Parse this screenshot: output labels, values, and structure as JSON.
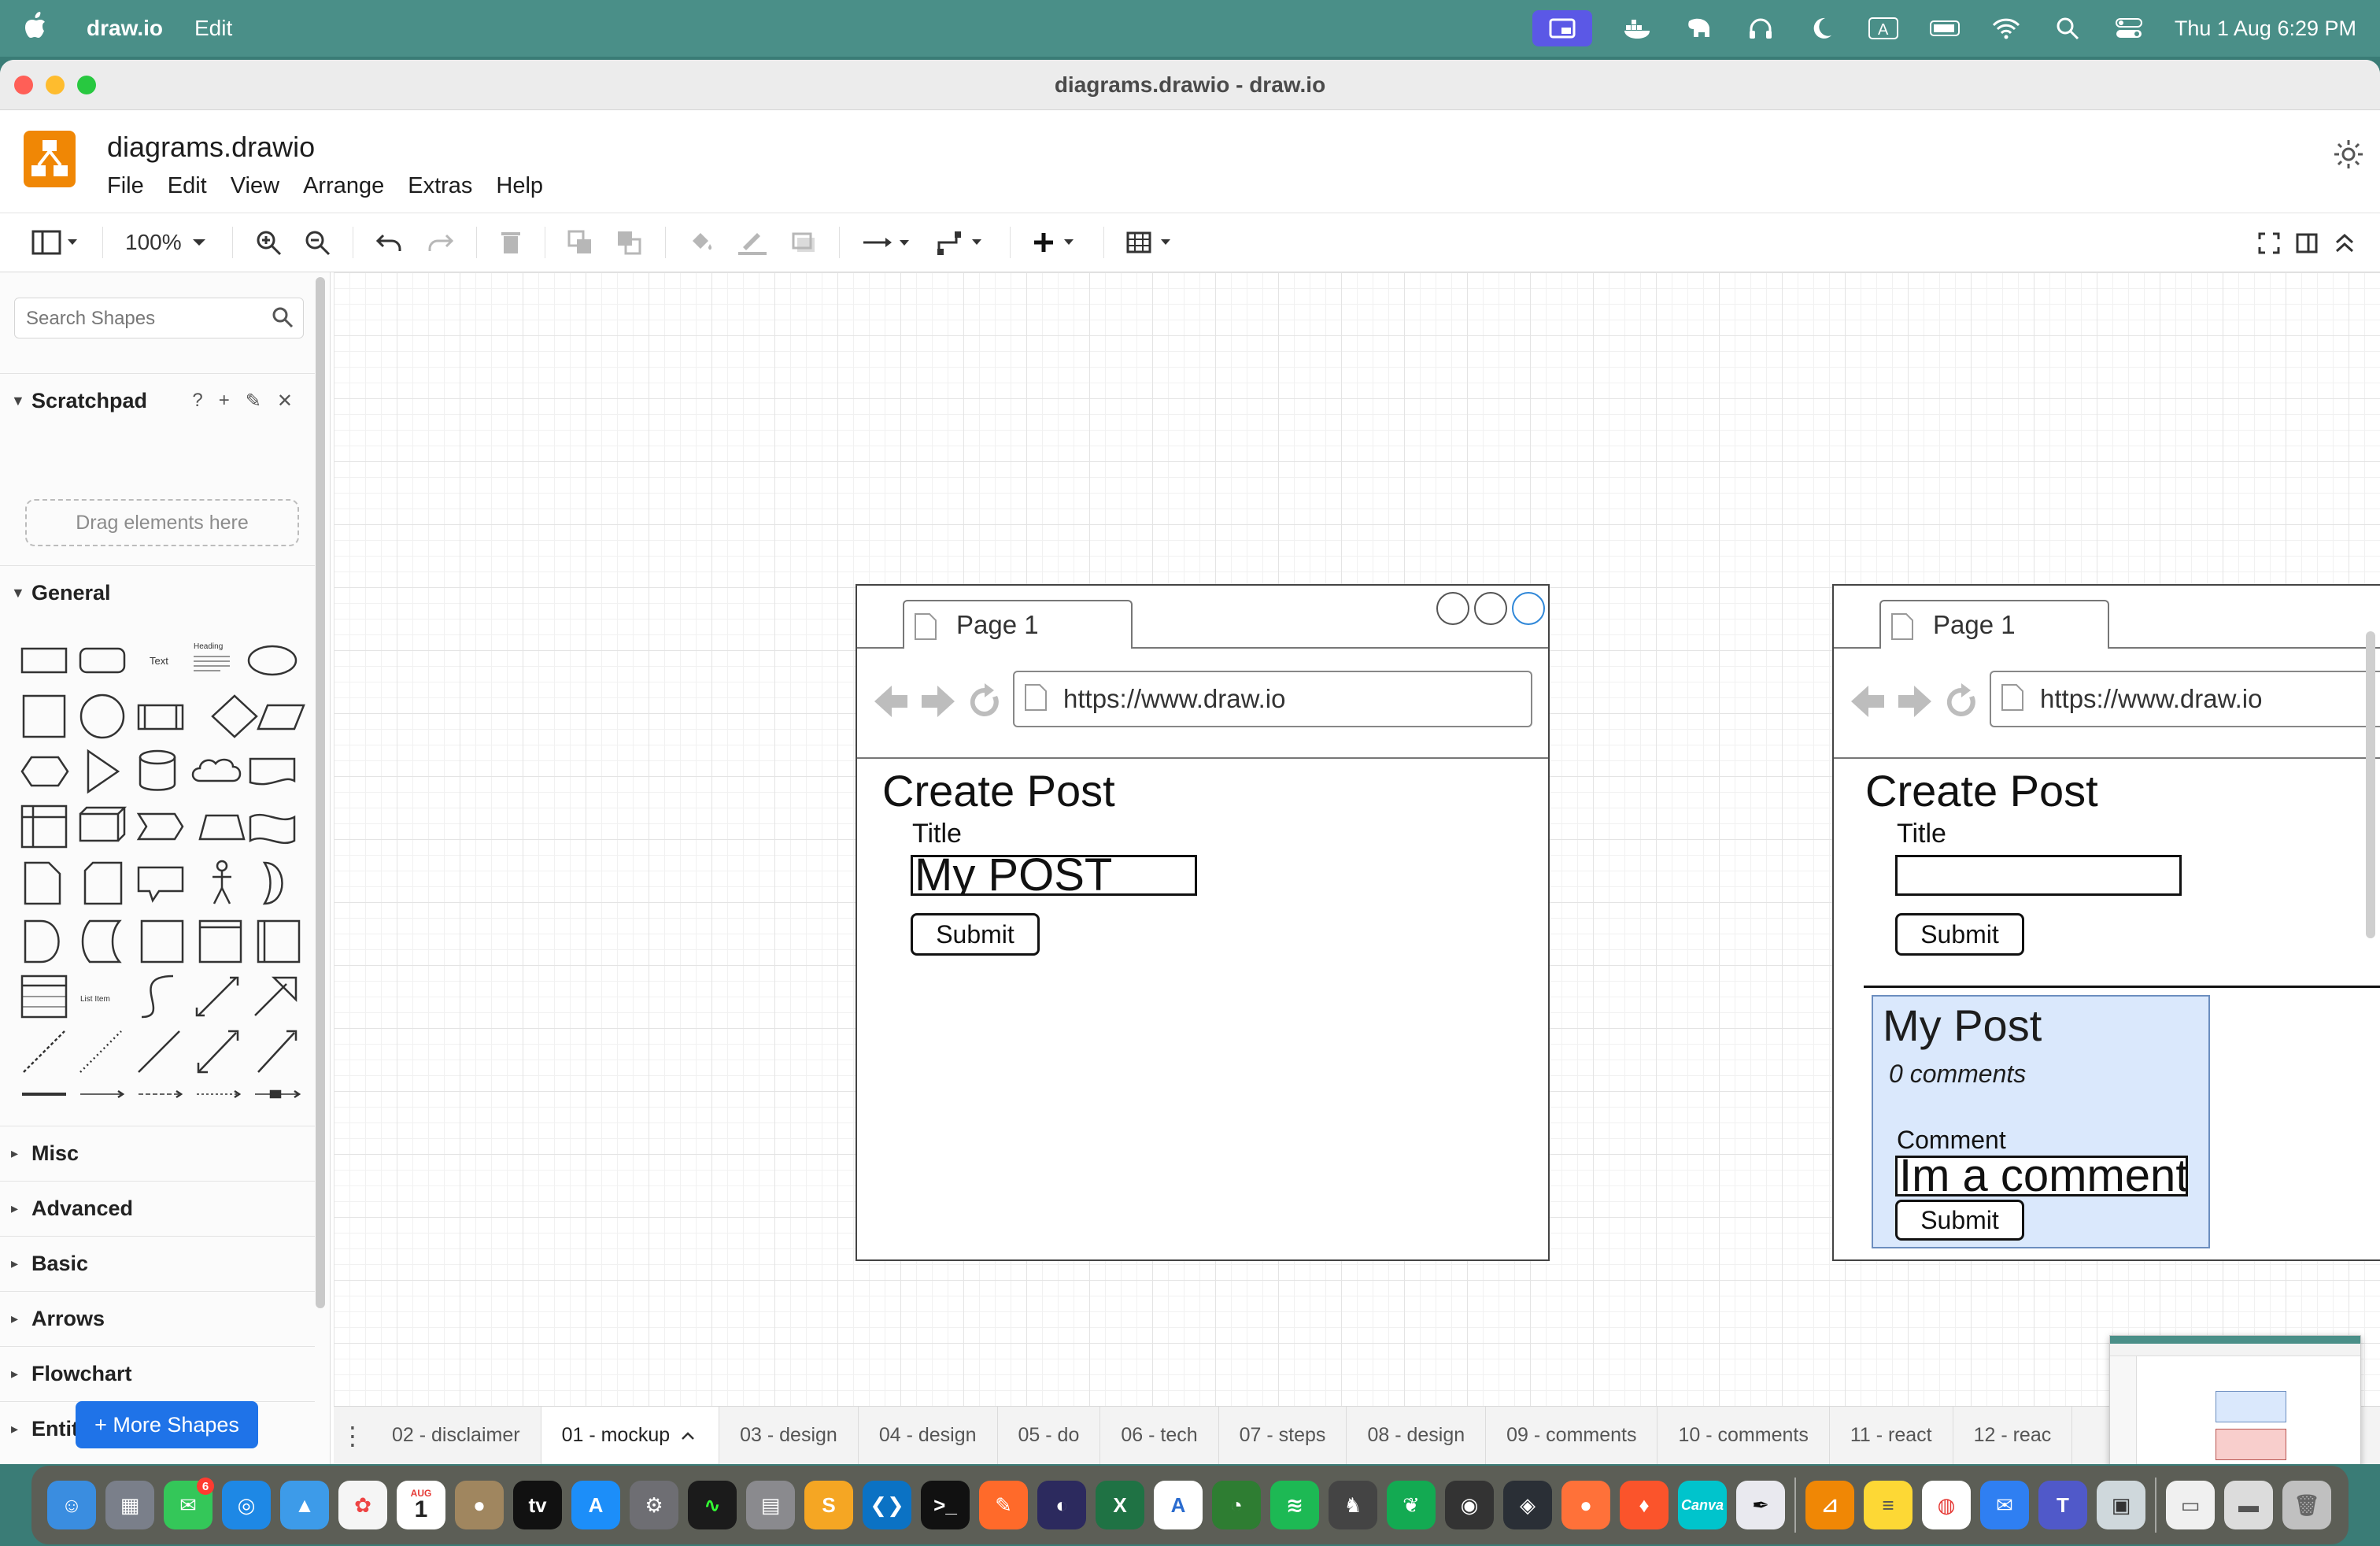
{
  "menubar": {
    "app_name": "draw.io",
    "menu": [
      "Edit"
    ],
    "clock": "Thu 1 Aug  6:29 PM",
    "status_icons": [
      "screen-mirroring-icon",
      "docker-icon",
      "elephant-icon",
      "headphones-icon",
      "moon-icon",
      "input-source-icon",
      "battery-icon",
      "wifi-icon",
      "spotlight-icon",
      "control-center-icon"
    ]
  },
  "window": {
    "title": "diagrams.drawio - draw.io",
    "doc_title": "diagrams.drawio",
    "menu": [
      "File",
      "Edit",
      "View",
      "Arrange",
      "Extras",
      "Help"
    ]
  },
  "toolbar": {
    "zoom": "100%"
  },
  "sidebar": {
    "search_placeholder": "Search Shapes",
    "scratchpad_title": "Scratchpad",
    "scratchpad_help": "?",
    "drag_hint": "Drag elements here",
    "general_title": "General",
    "shape_text": "Text",
    "shape_heading": "Heading",
    "shape_list_item": "List Item",
    "sections": [
      "Misc",
      "Advanced",
      "Basic",
      "Arrows",
      "Flowchart",
      "Entity Relation"
    ],
    "more_shapes": "+ More Shapes"
  },
  "mockup_left": {
    "tab": "Page 1",
    "url": "https://www.draw.io",
    "heading": "Create Post",
    "title_label": "Title",
    "title_value": "My POST",
    "submit": "Submit"
  },
  "mockup_right": {
    "tab": "Page 1",
    "url": "https://www.draw.io",
    "heading": "Create Post",
    "title_label": "Title",
    "title_value": "",
    "submit": "Submit",
    "post_title": "My Post",
    "post_comments": "0 comments",
    "comment_label": "Comment",
    "comment_value": "Im a comment",
    "comment_submit": "Submit"
  },
  "page_tabs": [
    {
      "label": "02 - disclaimer",
      "active": false
    },
    {
      "label": "01 - mockup",
      "active": true
    },
    {
      "label": "03 - design",
      "active": false
    },
    {
      "label": "04 - design",
      "active": false
    },
    {
      "label": "05 - do",
      "active": false
    },
    {
      "label": "06 - tech",
      "active": false
    },
    {
      "label": "07 - steps",
      "active": false
    },
    {
      "label": "08 - design",
      "active": false
    },
    {
      "label": "09 - comments",
      "active": false
    },
    {
      "label": "10 - comments",
      "active": false
    },
    {
      "label": "11 - react",
      "active": false
    },
    {
      "label": "12 - reac",
      "active": false
    }
  ],
  "dock": {
    "calendar_month": "AUG",
    "calendar_day": "1",
    "messages_badge": "6",
    "canva_label": "Canva"
  },
  "colors": {
    "menubar": "#4a8f88",
    "accent": "#1f73e8",
    "drawio_orange": "#f08705",
    "post_card_fill": "#dae8fc",
    "post_card_stroke": "#6c8ebf"
  }
}
